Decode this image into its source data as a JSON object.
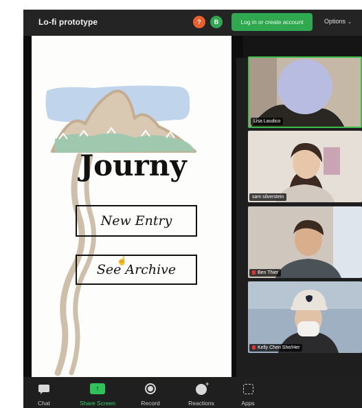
{
  "window": {
    "title": "Lo-fi prototype"
  },
  "header": {
    "badge_question": "?",
    "badge_user": "B",
    "login_label": "Log in or create account",
    "options_label": "Options",
    "options_chevron": "⌄"
  },
  "shared_screen": {
    "app_title": "Journy",
    "buttons": [
      {
        "label": "New Entry"
      },
      {
        "label": "See Archive"
      }
    ],
    "colors": {
      "sky": "#b9d0ea",
      "mountain": "#d9c8b2",
      "forest": "#9fc8ae",
      "path": "#cdbfa9"
    }
  },
  "participants": [
    {
      "name": "Lisa Laudico",
      "muted": false,
      "active_speaker": true
    },
    {
      "name": "sam silverstein",
      "muted": false,
      "active_speaker": false
    },
    {
      "name": "Ben Thier",
      "muted": true,
      "active_speaker": false
    },
    {
      "name": "Kelly Chen She/Her",
      "muted": true,
      "active_speaker": false
    }
  ],
  "toolbar": {
    "items": [
      {
        "label": "Chat",
        "icon": "chat-icon"
      },
      {
        "label": "Share Screen",
        "icon": "share-screen-icon"
      },
      {
        "label": "Record",
        "icon": "record-icon"
      },
      {
        "label": "Reactions",
        "icon": "reactions-icon"
      },
      {
        "label": "Apps",
        "icon": "apps-icon"
      }
    ],
    "accent_color": "#2fc25a"
  }
}
